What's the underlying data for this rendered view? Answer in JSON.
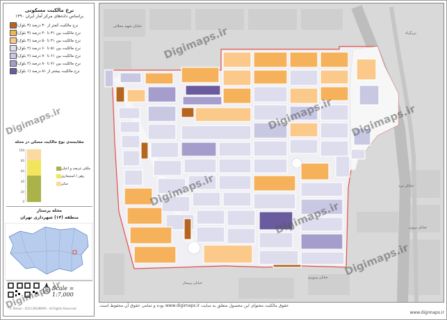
{
  "title": "نرخ مالکیت مسکونی",
  "subtitle": "براساس داده‌های مرکز آمار ایران ۱۳۹۰",
  "legend": [
    {
      "label": "نرخ مالکیت کمتر از ۳۰ درصد (۳ بلوک)",
      "color": "#b5651d"
    },
    {
      "label": "نرخ مالکیت بین ۳۱ تا ۴۰ درصد (۳ بلوک)",
      "color": "#f6b25a"
    },
    {
      "label": "نرخ مالکیت بین ۴۱ تا ۵۰ درصد (۴ بلوک)",
      "color": "#fbc98a"
    },
    {
      "label": "نرخ مالکیت بین ۵۱ تا ۶۰ درصد (۲ بلوک)",
      "color": "#ddddee"
    },
    {
      "label": "نرخ مالکیت بین ۶۱ تا ۷۰ درصد (۲ بلوک)",
      "color": "#c9c8e3"
    },
    {
      "label": "نرخ مالکیت بین ۷۱ تا ۸۰ درصد (۲ بلوک)",
      "color": "#a59dcc"
    },
    {
      "label": "نرخ مالکیت بیشتر از ۸۱ درصد (۱ بلوک)",
      "color": "#6a5a9e"
    }
  ],
  "chart": {
    "title": "مقایسه‌ی نوع مالکیت مسکن در محله",
    "y_ticks": [
      "100",
      "80",
      "60",
      "40",
      "20",
      "0"
    ],
    "categories": [
      {
        "label": "ملکی عرصه و اعیان",
        "color": "#aab24a"
      },
      {
        "label": "رهن / استیجاری",
        "color": "#f2e55c"
      },
      {
        "label": "سایر",
        "color": "#fbd9a0"
      }
    ]
  },
  "area": {
    "neighborhood": "محله پرستار",
    "district": "منطقه (۱۴) شهرداری تهران"
  },
  "scale_text": "Scale = 1:7,000",
  "north_label": "N",
  "watermark": "Digimaps.ir",
  "footer_line1": "حقوق مالکیت محتوای این محصول متعلق به سایت www.digimaps.ir بوده و تمامی حقوق آن محفوظ است.",
  "footer_line2": "www.digimaps.ir",
  "copyright_small": "© Tehran - 2013 DIGIMAPS - All Rights Reserved",
  "streets": [
    "خیابان پیروزی",
    "خیابان نبرد",
    "خیابان پرستار",
    "بزرگراه",
    "خیابان شهید محلاتی",
    "خیابان پروین"
  ],
  "colors": {
    "boundary": "#e0504a",
    "road": "#f4f4f4",
    "background": "#d9d9d9",
    "light_block": "#e3e3ee"
  }
}
